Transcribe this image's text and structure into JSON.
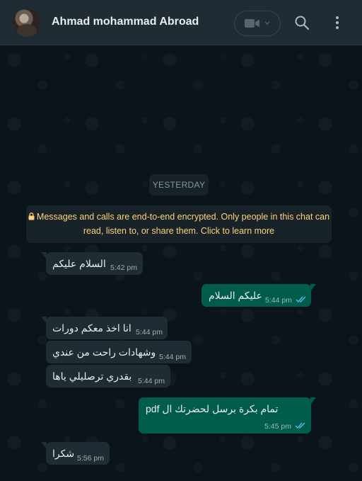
{
  "header": {
    "contact_name": "Ahmad mohammad Abroad",
    "icons": [
      "avatar",
      "video-call-icon",
      "chevron-down-icon",
      "search-icon",
      "menu-icon"
    ]
  },
  "chat": {
    "day_label": "YESTERDAY",
    "encryption_notice": "Messages and calls are end-to-end encrypted. Only people in this chat can read, listen to, or share them. Click to learn more",
    "messages": [
      {
        "direction": "in",
        "text": "السلام عليكم",
        "time": "5:42 pm"
      },
      {
        "direction": "out",
        "text": "عليكم السلام",
        "time": "5:44 pm",
        "status": "read"
      },
      {
        "direction": "in",
        "text": "انا اخذ معكم دورات",
        "time": "5:44 pm"
      },
      {
        "direction": "in",
        "text": "وشهادات راحت من عندي",
        "time": "5:44 pm"
      },
      {
        "direction": "in",
        "text": "بقدري ترصليلي ياها",
        "time": "5:44 pm"
      },
      {
        "direction": "out",
        "text": "تمام بكرة برسل لحضرتك ال pdf",
        "time": "5:45 pm",
        "status": "read"
      },
      {
        "direction": "in",
        "text": "شكرا",
        "time": "5:56 pm"
      }
    ]
  },
  "colors": {
    "header_bg": "#202c33",
    "chat_bg": "#0b141a",
    "incoming_bubble": "#202c33",
    "outgoing_bubble": "#005c4b",
    "read_ticks": "#53bdeb",
    "notice_text": "#ffd279"
  }
}
